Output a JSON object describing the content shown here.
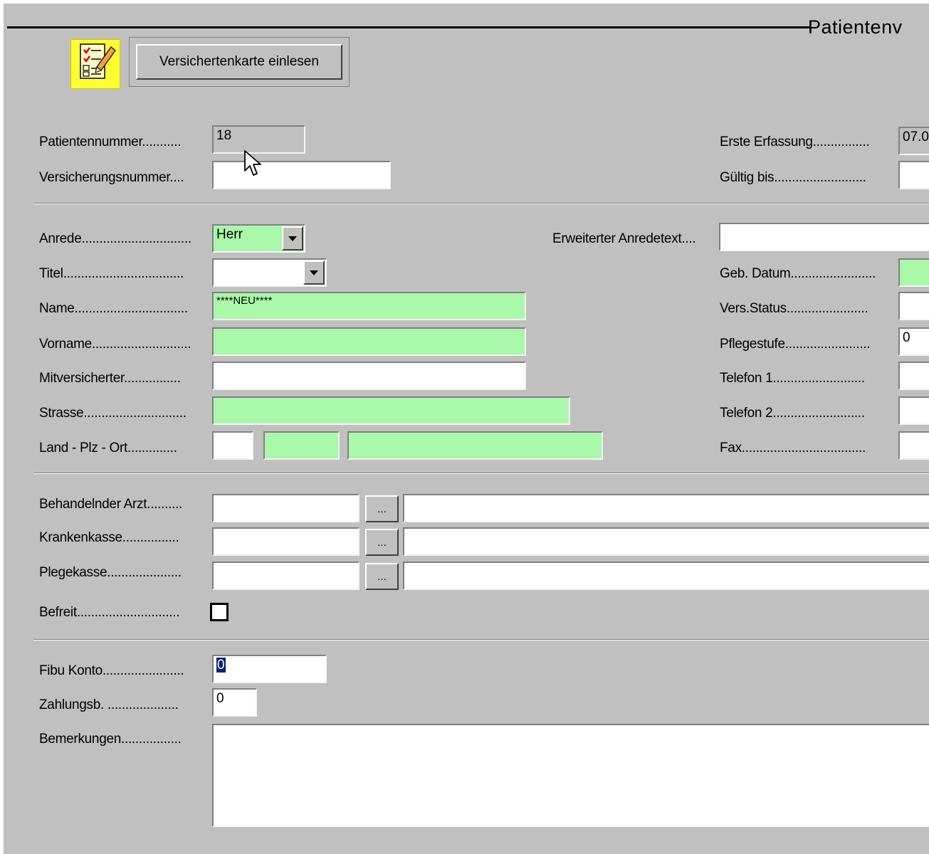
{
  "header": {
    "page_title": "Patientenv",
    "read_card_button": "Versichertenkarte einlesen",
    "app_icon": "form-edit-icon"
  },
  "labels": {
    "patientennummer": "Patientennummer...........",
    "versicherungsnummer": "Versicherungsnummer....",
    "erste_erfassung": "Erste Erfassung................",
    "gueltig_bis": "Gültig bis..........................",
    "anrede": "Anrede...............................",
    "erweiterter_anredetext": "Erweiterter Anredetext....",
    "titel": "Titel..................................",
    "geb_datum": "Geb. Datum........................",
    "name": "Name................................",
    "vers_status": "Vers.Status.......................",
    "vorname": "Vorname............................",
    "pflegestufe": "Pflegestufe........................",
    "mitversicherter": "Mitversicherter................",
    "telefon1": "Telefon 1..........................",
    "strasse": "Strasse.............................",
    "telefon2": "Telefon 2..........................",
    "land_plz_ort": "Land - Plz - Ort..............",
    "fax": "Fax...................................",
    "behandelnder_arzt": "Behandelnder Arzt..........",
    "krankenkasse": "Krankenkasse................",
    "plegekasse": "Plegekasse.....................",
    "befreit": "Befreit.............................",
    "fibu_konto": "Fibu Konto.......................",
    "zahlungsb": "Zahlungsb. ....................",
    "bemerkungen": "Bemerkungen................."
  },
  "values": {
    "patientennummer": "18",
    "versicherungsnummer": "",
    "erste_erfassung": "07.0",
    "gueltig_bis": "",
    "anrede": "Herr",
    "erweiterter_anredetext": "",
    "titel": "",
    "geb_datum": "",
    "name": "****NEU****",
    "vers_status": "",
    "vorname": "",
    "pflegestufe": "0",
    "mitversicherter": "",
    "telefon1": "",
    "strasse": "",
    "telefon2": "",
    "land": "",
    "plz": "",
    "ort": "",
    "fax": "",
    "arzt_code": "",
    "arzt_name": "",
    "krankenkasse_code": "",
    "krankenkasse_name": "",
    "plegekasse_code": "",
    "plegekasse_name": "",
    "befreit_checked": false,
    "fibu_konto": "0",
    "zahlungsb": "0",
    "bemerkungen": ""
  },
  "lookup_button_label": "...",
  "colors": {
    "required_field": "#a9f7a9",
    "window_bg": "#c0c0c0",
    "selection": "#0a1e7a"
  }
}
